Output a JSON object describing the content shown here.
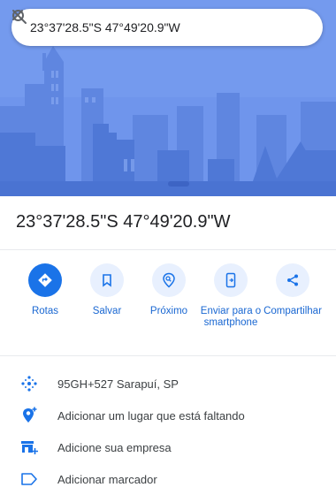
{
  "search": {
    "query": "23°37'28.5\"S 47°49'20.9\"W",
    "search_icon": "search-icon",
    "close_icon": "close-icon"
  },
  "place": {
    "title": "23°37'28.5\"S 47°49'20.9\"W"
  },
  "actions": [
    {
      "label": "Rotas",
      "icon": "directions-icon"
    },
    {
      "label": "Salvar",
      "icon": "bookmark-icon"
    },
    {
      "label": "Próximo",
      "icon": "nearby-icon"
    },
    {
      "label": "Enviar para o smartphone",
      "icon": "send-to-phone-icon"
    },
    {
      "label": "Compartilhar",
      "icon": "share-icon"
    }
  ],
  "info": [
    {
      "text": "95GH+527 Sarapuí, SP",
      "icon": "plus-code-icon"
    },
    {
      "text": "Adicionar um lugar que está faltando",
      "icon": "add-place-icon"
    },
    {
      "text": "Adicione sua empresa",
      "icon": "store-icon"
    },
    {
      "text": "Adicionar marcador",
      "icon": "label-icon"
    }
  ],
  "colors": {
    "accent": "#1a73e8",
    "hero_background": "#6d93ea",
    "action_circle": "#e8f0fe"
  }
}
